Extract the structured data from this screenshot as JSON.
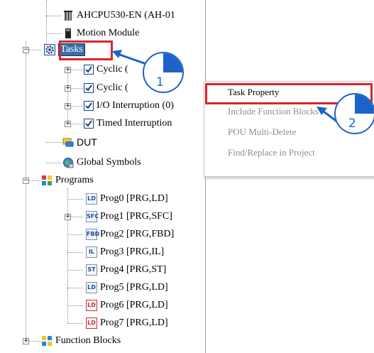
{
  "tree": {
    "cpu": "AHCPU530-EN  (AH-01",
    "motion": "Motion Module",
    "tasks": "Tasks",
    "task_items": [
      "Cyclic (",
      "Cyclic (",
      "I/O Interruption (0)",
      "Timed Interruption"
    ],
    "dut": "DUT",
    "global_symbols": "Global Symbols",
    "programs": "Programs",
    "program_items": [
      "Prog0 [PRG,LD]",
      "Prog1 [PRG,SFC]",
      "Prog2 [PRG,FBD]",
      "Prog3 [PRG,IL]",
      "Prog4 [PRG,ST]",
      "Prog5 [PRG,LD]",
      "Prog6 [PRG,LD]",
      "Prog7 [PRG,LD]"
    ],
    "program_icon_letters": [
      "LD",
      "SFC",
      "FBD",
      "IL",
      "ST",
      "LD",
      "LD",
      "LD"
    ],
    "function_blocks": "Function Blocks"
  },
  "context_menu": {
    "items": [
      "Task Property",
      "Include Function Blocks",
      "POU Multi-Delete",
      "Find/Replace in Project"
    ],
    "enabled": [
      true,
      false,
      false,
      false
    ]
  },
  "annotations": {
    "step1": "1",
    "step2": "2"
  },
  "colors": {
    "highlight": "#d8262e",
    "callout": "#1c63c9",
    "selection": "#3a6ea5"
  }
}
